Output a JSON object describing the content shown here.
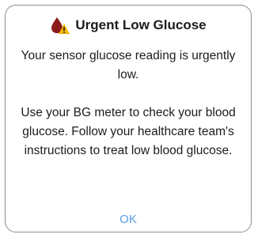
{
  "dialog": {
    "title": "Urgent Low Glucose",
    "icon": "blood-drop-warning-icon",
    "message_line1": "Your sensor glucose reading is urgently low.",
    "message_line2": "Use your BG meter to check your blood glucose. Follow your healthcare team's instructions to treat low blood glucose.",
    "ok_label": "OK"
  },
  "colors": {
    "drop": "#8b1a1a",
    "warning": "#f2b705",
    "ok_link": "#5a9be6",
    "text": "#1c1c1e",
    "border": "#8e8e93"
  }
}
